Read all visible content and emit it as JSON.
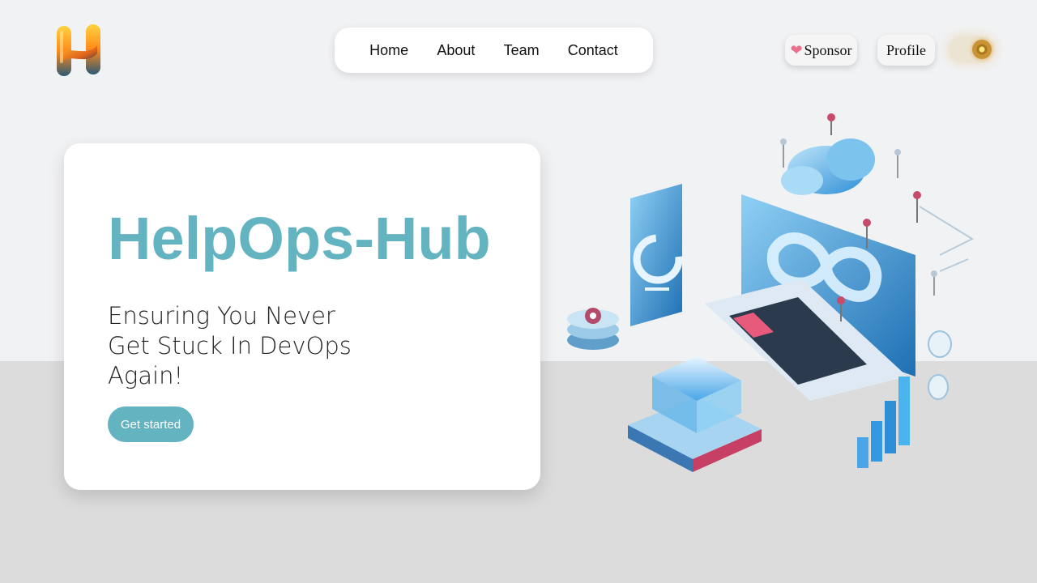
{
  "brand": {
    "logo_icon": "letter-h-logo",
    "accent_color": "#63b3c1"
  },
  "nav": {
    "items": [
      {
        "label": "Home"
      },
      {
        "label": "About"
      },
      {
        "label": "Team"
      },
      {
        "label": "Contact"
      }
    ]
  },
  "header_actions": {
    "sponsor_label": "Sponsor",
    "sponsor_icon": "heart-icon",
    "profile_label": "Profile",
    "theme_toggle_icon": "sun-icon"
  },
  "hero": {
    "title": "HelpOps-Hub",
    "subtitle": "Ensuring You Never Get Stuck In DevOps Again!",
    "cta_label": "Get started",
    "illustration_icon": "devops-isometric-illustration"
  }
}
